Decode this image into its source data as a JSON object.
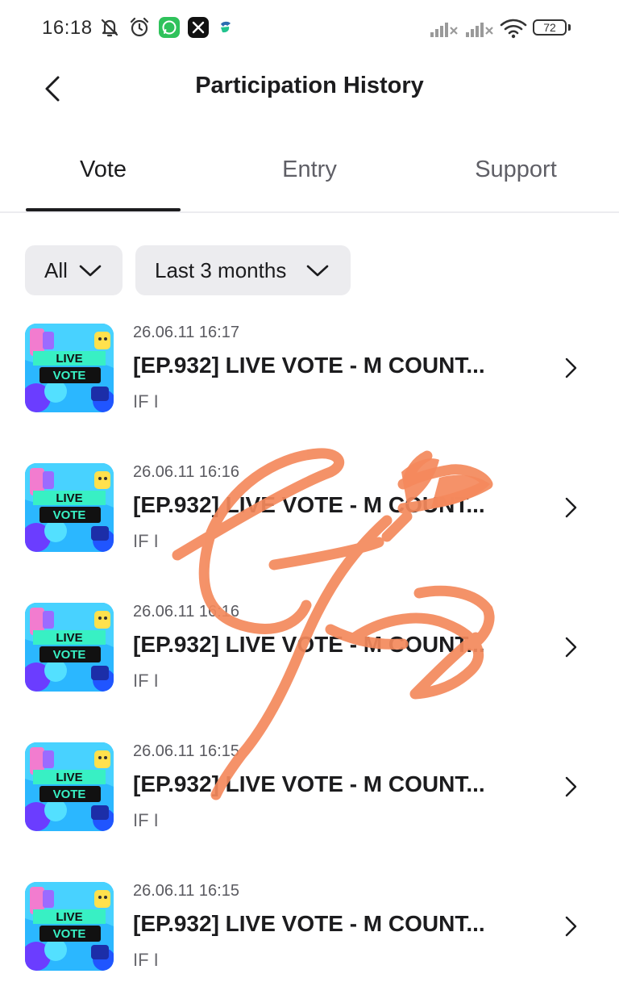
{
  "status_bar": {
    "time": "16:18",
    "battery": "72",
    "left_icons": [
      "mute-bell-icon",
      "alarm-icon",
      "whatsapp-icon",
      "x-icon",
      "app-icon"
    ],
    "right_icons": [
      "signal-icon",
      "signal-icon",
      "wifi-icon",
      "battery-icon"
    ]
  },
  "header": {
    "title": "Participation History",
    "back_icon": "chevron-left-icon"
  },
  "tabs": [
    {
      "label": "Vote",
      "active": true
    },
    {
      "label": "Entry",
      "active": false
    },
    {
      "label": "Support",
      "active": false
    }
  ],
  "filters": {
    "type": "All",
    "period": "Last 3 months"
  },
  "items": [
    {
      "date": "26.06.11 16:17",
      "title": "[EP.932] LIVE VOTE - M COUNT...",
      "artist": "IF I",
      "thumb_line1": "LIVE",
      "thumb_line2": "VOTE"
    },
    {
      "date": "26.06.11 16:16",
      "title": "[EP.932] LIVE VOTE - M COUNT...",
      "artist": "IF I",
      "thumb_line1": "LIVE",
      "thumb_line2": "VOTE"
    },
    {
      "date": "26.06.11 16:16",
      "title": "[EP.932] LIVE VOTE - M COUNT...",
      "artist": "IF I",
      "thumb_line1": "LIVE",
      "thumb_line2": "VOTE"
    },
    {
      "date": "26.06.11 16:15",
      "title": "[EP.932] LIVE VOTE - M COUNT...",
      "artist": "IF I",
      "thumb_line1": "LIVE",
      "thumb_line2": "VOTE"
    },
    {
      "date": "26.06.11 16:15",
      "title": "[EP.932] LIVE VOTE - M COUNT...",
      "artist": "IF I",
      "thumb_line1": "LIVE",
      "thumb_line2": "VOTE"
    }
  ],
  "colors": {
    "scribble": "#f4895c",
    "thumb_bg": "#2bb7ff",
    "thumb_accent": "#38f0c4"
  }
}
